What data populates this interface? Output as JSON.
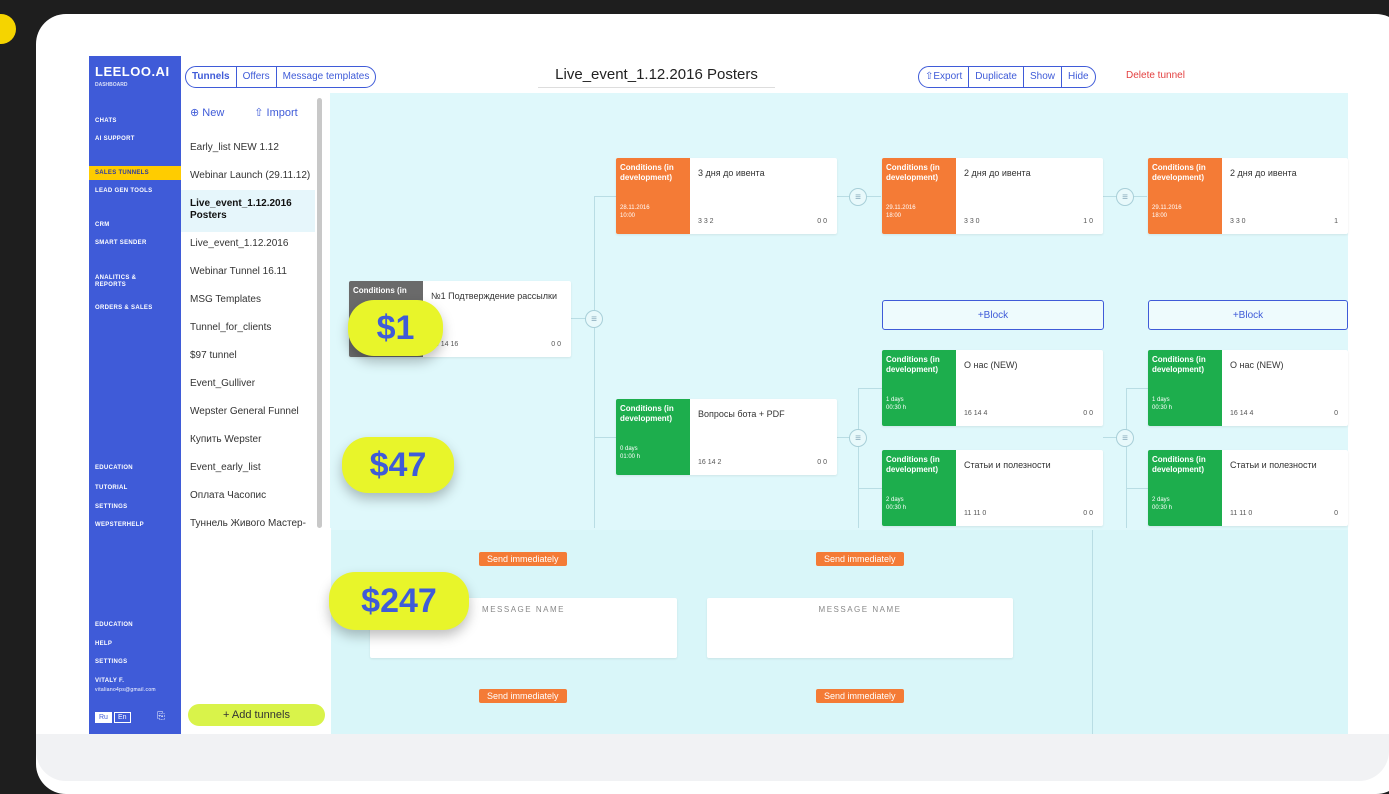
{
  "brand": {
    "name": "LEELOO.AI",
    "sub": "DASHBOARD"
  },
  "nav": {
    "items": [
      "CHATS",
      "AI SUPPORT",
      "SALES TUNNELS",
      "LEAD GEN TOOLS",
      "CRM",
      "SMART SENDER",
      "ANALITICS &\nREPORTS",
      "ORDERS & SALES",
      "EDUCATION",
      "TUTORIAL",
      "SETTINGS",
      "WEPSTERHELP"
    ],
    "bottom": [
      "EDUCATION",
      "HELP",
      "SETTINGS"
    ],
    "user_name": "VITALY F.",
    "user_email": "vitaliano4ps@gmail.com",
    "lang_ru": "Ru",
    "lang_en": "En"
  },
  "tabs": {
    "tunnels": "Tunnels",
    "offers": "Offers",
    "templates": "Message templates"
  },
  "title": "Live_event_1.12.2016 Posters",
  "actions": {
    "export": "⇧Export",
    "duplicate": "Duplicate",
    "show": "Show",
    "hide": "Hide",
    "delete": "Delete tunnel"
  },
  "list": {
    "new": "⊕ New",
    "import": "⇧ Import",
    "items": [
      "Early_list NEW 1.12",
      "Webinar Launch (29.11.12)",
      "Live_event_1.12.2016 Posters",
      "Live_event_1.12.2016",
      "Webinar Tunnel 16.11",
      "MSG Templates",
      "Tunnel_for_clients",
      "$97 tunnel",
      "Event_Gulliver",
      "Wepster General Funnel",
      "Купить Wepster",
      "Event_early_list",
      "Оплата Часопис",
      "Туннель Живого Мастер-"
    ],
    "add": "+ Add tunnels"
  },
  "cards": {
    "c1": {
      "cond": "Conditions (in",
      "name": "№1 Подтверждение рассылки",
      "stats": "16  14  16",
      "stats2": "0  0"
    },
    "c2": {
      "cond": "Conditions (in development)",
      "when": "28.11.2016\n10:00",
      "name": "3 дня до ивента",
      "stats": "3    3    2",
      "stats2": "0  0"
    },
    "c3": {
      "cond": "Conditions (in development)",
      "when": "29.11.2016\n18:00",
      "name": "2 дня до ивента",
      "stats": "3    3    0",
      "stats2": "1  0"
    },
    "c4": {
      "cond": "Conditions (in development)",
      "when": "29.11.2016\n18:00",
      "name": "2 дня до ивента",
      "stats": "3    3    0",
      "stats2": "1"
    },
    "c5": {
      "cond": "Conditions (in development)",
      "when": "0 days\n01:00 h",
      "name": "Вопросы бота + PDF",
      "stats": "16   14   2",
      "stats2": "0  0"
    },
    "c6": {
      "cond": "Conditions (in development)",
      "when": "1 days\n00:30 h",
      "name": "О нас (NEW)",
      "stats": "16   14   4",
      "stats2": "0  0"
    },
    "c7": {
      "cond": "Conditions (in development)",
      "when": "1 days\n00:30 h",
      "name": "О нас (NEW)",
      "stats": "16   14   4",
      "stats2": "0"
    },
    "c8": {
      "cond": "Conditions (in development)",
      "when": "2 days\n00:30 h",
      "name": "Статьи и полезности",
      "stats": "11   11   0",
      "stats2": "0  0"
    },
    "c9": {
      "cond": "Conditions (in development)",
      "when": "2 days\n00:30 h",
      "name": "Статьи и полезности",
      "stats": "11   11   0",
      "stats2": "0"
    }
  },
  "block_label": "+Block",
  "send_label": "Send immediately",
  "message_name": "MESSAGE NAME",
  "prices": {
    "p1": "$1",
    "p2": "$47",
    "p3": "$247"
  },
  "colors": {
    "accent": "#3f5bd8",
    "orange": "#f47b36",
    "green": "#1dae4d",
    "lime": "#e8f52a"
  }
}
